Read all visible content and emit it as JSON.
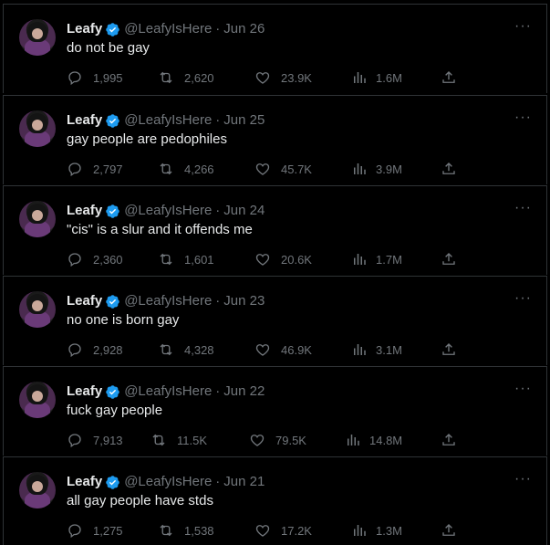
{
  "user": {
    "name": "Leafy",
    "handle": "@LeafyIsHere"
  },
  "colors": {
    "background": "#000000",
    "text": "#e7e9ea",
    "muted": "#71767b",
    "verified": "#1d9bf0",
    "divider": "#2f3336"
  },
  "tweets": [
    {
      "date": "Jun 26",
      "text": "do not be gay",
      "replies": "1,995",
      "retweets": "2,620",
      "likes": "23.9K",
      "views": "1.6M"
    },
    {
      "date": "Jun 25",
      "text": "gay people are pedophiles",
      "replies": "2,797",
      "retweets": "4,266",
      "likes": "45.7K",
      "views": "3.9M"
    },
    {
      "date": "Jun 24",
      "text": "\"cis\" is a slur and it offends me",
      "replies": "2,360",
      "retweets": "1,601",
      "likes": "20.6K",
      "views": "1.7M"
    },
    {
      "date": "Jun 23",
      "text": "no one is born gay",
      "replies": "2,928",
      "retweets": "4,328",
      "likes": "46.9K",
      "views": "3.1M"
    },
    {
      "date": "Jun 22",
      "text": "fuck gay people",
      "replies": "7,913",
      "retweets": "11.5K",
      "likes": "79.5K",
      "views": "14.8M"
    },
    {
      "date": "Jun 21",
      "text": "all gay people have stds",
      "replies": "1,275",
      "retweets": "1,538",
      "likes": "17.2K",
      "views": "1.3M"
    }
  ],
  "icons": {
    "verified": "verified-badge-icon",
    "more": "more-horizontal-icon",
    "reply": "reply-icon",
    "retweet": "retweet-icon",
    "like": "heart-icon",
    "views": "views-chart-icon",
    "share": "share-icon"
  },
  "symbols": {
    "separator": "·",
    "more": "···"
  }
}
